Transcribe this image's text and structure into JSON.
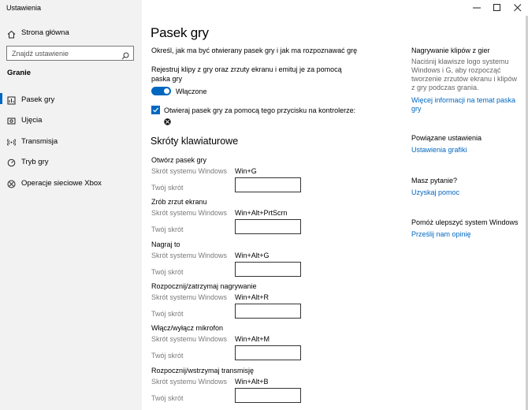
{
  "window": {
    "title": "Ustawienia"
  },
  "sidebar": {
    "home_label": "Strona główna",
    "search_placeholder": "Znajdź ustawienie",
    "section": "Granie",
    "items": [
      {
        "label": "Pasek gry",
        "icon": "game-bar-icon",
        "active": true
      },
      {
        "label": "Ujęcia",
        "icon": "captures-icon",
        "active": false
      },
      {
        "label": "Transmisja",
        "icon": "broadcast-icon",
        "active": false
      },
      {
        "label": "Tryb gry",
        "icon": "game-mode-icon",
        "active": false
      },
      {
        "label": "Operacje sieciowe Xbox",
        "icon": "xbox-icon",
        "active": false
      }
    ]
  },
  "main": {
    "title": "Pasek gry",
    "description": "Określ, jak ma być otwierany pasek gry i jak ma rozpoznawać grę",
    "record_text": "Rejestruj klipy z gry oraz zrzuty ekranu i emituj je za pomocą paska gry",
    "toggle_label": "Włączone",
    "toggle_on": true,
    "controller_label": "Otwieraj pasek gry za pomocą tego przycisku na kontrolerze:",
    "controller_checked": true,
    "shortcuts_title": "Skróty klawiaturowe",
    "system_shortcut_label": "Skrót systemu Windows",
    "your_shortcut_label": "Twój skrót",
    "shortcuts": [
      {
        "title": "Otwórz pasek gry",
        "system": "Win+G",
        "yours": ""
      },
      {
        "title": "Zrób zrzut ekranu",
        "system": "Win+Alt+PrtScrn",
        "yours": ""
      },
      {
        "title": "Nagraj to",
        "system": "Win+Alt+G",
        "yours": ""
      },
      {
        "title": "Rozpocznij/zatrzymaj nagrywanie",
        "system": "Win+Alt+R",
        "yours": ""
      },
      {
        "title": "Włącz/wyłącz mikrofon",
        "system": "Win+Alt+M",
        "yours": ""
      },
      {
        "title": "Rozpocznij/wstrzymaj transmisję",
        "system": "Win+Alt+B",
        "yours": ""
      }
    ]
  },
  "aside": {
    "record_heading": "Nagrywanie klipów z gier",
    "record_text": "Naciśnij klawisze logo systemu Windows i G, aby rozpocząć tworzenie zrzutów ekranu i klipów z gry podczas grania.",
    "record_link": "Więcej informacji na temat paska gry",
    "related_heading": "Powiązane ustawienia",
    "related_link": "Ustawienia grafiki",
    "question_heading": "Masz pytanie?",
    "question_link": "Uzyskaj pomoc",
    "improve_heading": "Pomóż ulepszyć system Windows",
    "improve_link": "Prześlij nam opinię"
  },
  "colors": {
    "accent": "#0067c0",
    "sidebar_bg": "#f2f2f2"
  }
}
